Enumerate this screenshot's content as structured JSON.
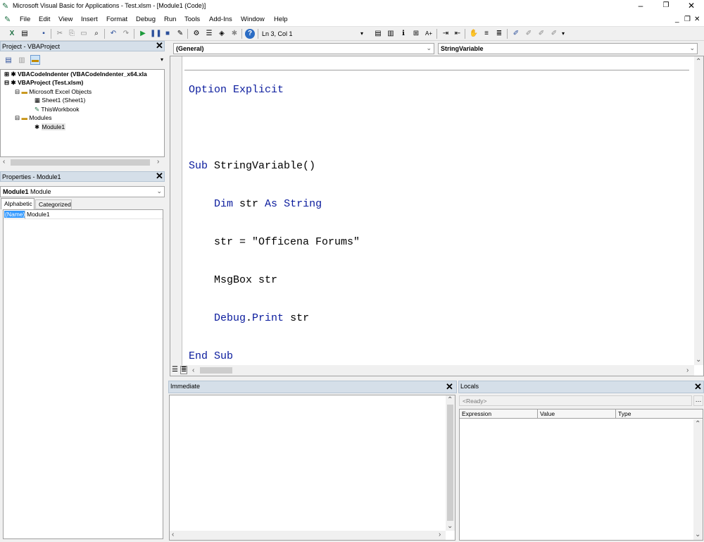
{
  "window": {
    "title": "Microsoft Visual Basic for Applications - Test.xlsm - [Module1 (Code)]"
  },
  "menu": [
    "File",
    "Edit",
    "View",
    "Insert",
    "Format",
    "Debug",
    "Run",
    "Tools",
    "Add-Ins",
    "Window",
    "Help"
  ],
  "toolbar": {
    "position": "Ln 3, Col 1"
  },
  "project": {
    "title": "Project - VBAProject",
    "tree": [
      {
        "label": "VBACodeIndenter (VBACodeIndenter_x64.xla",
        "bold": true
      },
      {
        "label": "VBAProject (Test.xlsm)",
        "bold": true
      },
      {
        "label": "Microsoft Excel Objects"
      },
      {
        "label": "Sheet1 (Sheet1)"
      },
      {
        "label": "ThisWorkbook"
      },
      {
        "label": "Modules"
      },
      {
        "label": "Module1"
      }
    ]
  },
  "properties": {
    "title": "Properties - Module1",
    "object_name": "Module1",
    "object_type": "Module",
    "tabs": [
      "Alphabetic",
      "Categorized"
    ],
    "rows": [
      {
        "name": "(Name)",
        "value": "Module1"
      }
    ]
  },
  "code": {
    "object_combo": "(General)",
    "proc_combo": "StringVariable",
    "lines": [
      "Option Explicit",
      "",
      "Sub StringVariable()",
      "    Dim str As String",
      "    str = \"Officena Forums\"",
      "    MsgBox str",
      "    Debug.Print str",
      "End Sub"
    ]
  },
  "immediate": {
    "title": "Immediate"
  },
  "locals": {
    "title": "Locals",
    "status": "<Ready>",
    "columns": [
      "Expression",
      "Value",
      "Type"
    ]
  },
  "colors": {
    "keyword": "#0a1b9d",
    "pane_header": "#d5dfe9",
    "selection": "#3399ff"
  }
}
